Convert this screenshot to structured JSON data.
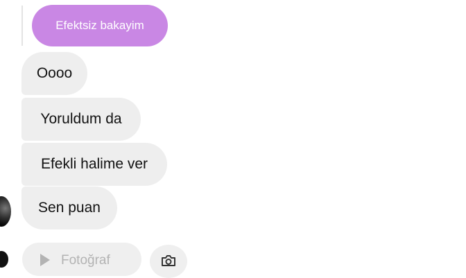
{
  "quoted_message": {
    "text": "Efektsiz bakayim",
    "color": "#c987e4"
  },
  "messages": [
    {
      "text": "Oooo"
    },
    {
      "text": "Yoruldum da"
    },
    {
      "text": "Efekli halime ver"
    },
    {
      "text": "Sen puan"
    }
  ],
  "composer": {
    "partial_text": "Fotoğraf",
    "icons": [
      "play-icon",
      "camera-icon"
    ]
  },
  "colors": {
    "incoming_bubble": "#eeeeee",
    "background": "#ffffff"
  }
}
